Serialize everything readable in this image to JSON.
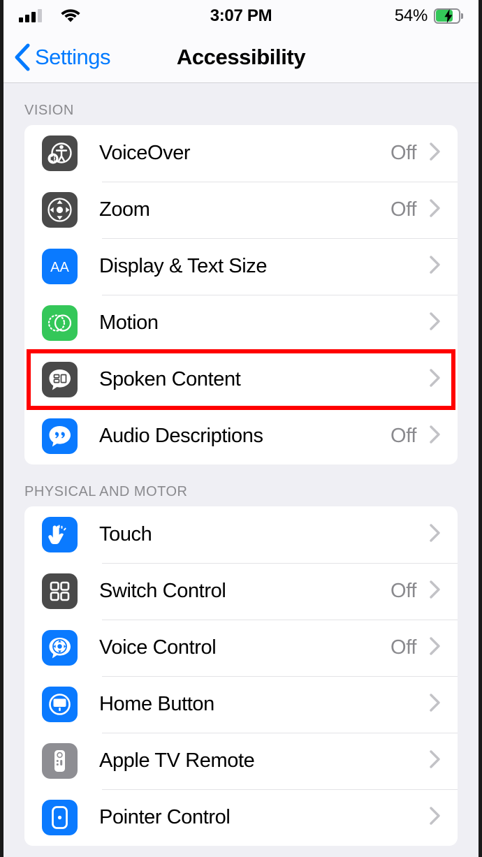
{
  "status_bar": {
    "time": "3:07 PM",
    "battery_percent": "54%",
    "signal_icon": "cellular-bars-icon",
    "wifi_icon": "wifi-icon",
    "battery_icon": "battery-charging-icon",
    "signal_bars_filled": 3,
    "signal_bars_total": 4,
    "battery_level": 54,
    "charging": true
  },
  "nav_bar": {
    "back_label": "Settings",
    "back_icon": "chevron-left-icon",
    "title": "Accessibility"
  },
  "colors": {
    "accent_blue": "#007aff",
    "icon_blue": "#0a7aff",
    "icon_green": "#34c759",
    "icon_dark": "#4a4a4a",
    "icon_gray": "#8e8e93",
    "highlight_red": "#ff0000",
    "page_background": "#efeff4",
    "card_background": "#ffffff",
    "value_gray": "#8a8a8e"
  },
  "sections": [
    {
      "header": "VISION",
      "rows": [
        {
          "label": "VoiceOver",
          "value": "Off",
          "icon": "voiceover-icon",
          "icon_style": "dark",
          "highlighted": false
        },
        {
          "label": "Zoom",
          "value": "Off",
          "icon": "zoom-magnify-icon",
          "icon_style": "dark",
          "highlighted": false
        },
        {
          "label": "Display & Text Size",
          "value": "",
          "icon": "display-text-size-icon",
          "icon_style": "blue",
          "highlighted": false
        },
        {
          "label": "Motion",
          "value": "",
          "icon": "motion-icon",
          "icon_style": "green",
          "highlighted": false
        },
        {
          "label": "Spoken Content",
          "value": "",
          "icon": "spoken-content-icon",
          "icon_style": "dark",
          "highlighted": true
        },
        {
          "label": "Audio Descriptions",
          "value": "Off",
          "icon": "audio-descriptions-icon",
          "icon_style": "blue",
          "highlighted": false
        }
      ]
    },
    {
      "header": "PHYSICAL AND MOTOR",
      "rows": [
        {
          "label": "Touch",
          "value": "",
          "icon": "touch-hand-icon",
          "icon_style": "blue",
          "highlighted": false
        },
        {
          "label": "Switch Control",
          "value": "Off",
          "icon": "switch-control-grid-icon",
          "icon_style": "dark",
          "highlighted": false
        },
        {
          "label": "Voice Control",
          "value": "Off",
          "icon": "voice-control-icon",
          "icon_style": "blue",
          "highlighted": false
        },
        {
          "label": "Home Button",
          "value": "",
          "icon": "home-button-icon",
          "icon_style": "blue",
          "highlighted": false
        },
        {
          "label": "Apple TV Remote",
          "value": "",
          "icon": "apple-tv-remote-icon",
          "icon_style": "gray",
          "highlighted": false
        },
        {
          "label": "Pointer Control",
          "value": "",
          "icon": "pointer-control-icon",
          "icon_style": "blue",
          "highlighted": false
        }
      ]
    }
  ],
  "chevron_icon": "chevron-right-icon"
}
